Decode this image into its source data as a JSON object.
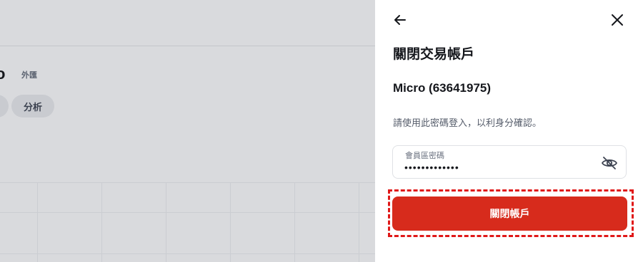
{
  "background": {
    "title_fragment": "o",
    "badge": "外匯",
    "pill_label": "分析"
  },
  "panel": {
    "title": "關閉交易帳戶",
    "account_name": "Micro (63641975)",
    "instruction": "請使用此密碼登入，以利身分確認。",
    "password_field": {
      "label": "會員區密碼",
      "value": "•••••••••••••"
    },
    "submit_label": "關閉帳戶",
    "icons": {
      "back": "arrow-left-icon",
      "close": "close-icon",
      "visibility": "eye-off-icon"
    },
    "colors": {
      "submit_bg": "#d72b1c",
      "highlight": "#e01818"
    }
  }
}
